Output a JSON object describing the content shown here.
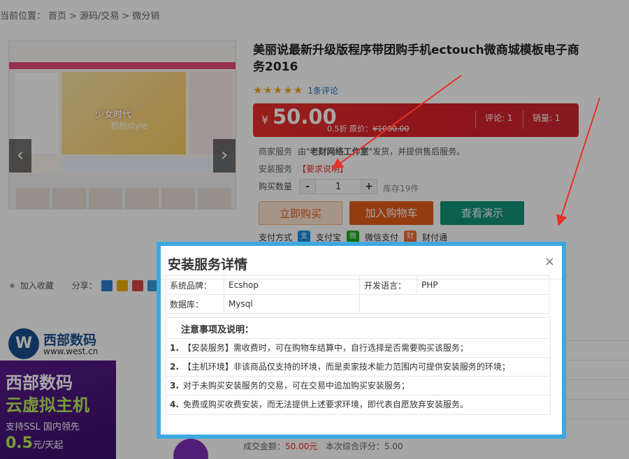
{
  "breadcrumb": {
    "label": "当前位置：",
    "home": "首页",
    "sep": ">",
    "cat": "源码/交易",
    "sub": "微分销"
  },
  "product": {
    "title": "美丽说最新升级版程序带团购手机ectouch微商城模板电子商务2016",
    "hero_banner_text": "少女时代",
    "hero_banner_sub": "初秋style",
    "rating": {
      "stars": 5,
      "star_glyph": "★★★★★",
      "reviews_label": "1条评论"
    },
    "price": {
      "symbol": "¥",
      "value": "50.00",
      "discount": "0.5折",
      "orig_label": "原价：",
      "orig": "¥1000.00",
      "reviews_stat": "评论: 1",
      "sales_stat": "销量: 1"
    },
    "merchant_label": "商家服务",
    "merchant_text_pre": "由\"",
    "merchant_name": "老财网络工作室",
    "merchant_text_post": "\"发货，并提供售后服务。",
    "install_label": "安装服务",
    "install_link": "【要求说明】",
    "qty_label": "购买数量",
    "qty_minus": "-",
    "qty_value": "1",
    "qty_plus": "+",
    "stock": "库存19件",
    "buttons": {
      "buy": "立即购买",
      "cart": "加入购物车",
      "demo": "查看演示"
    },
    "pay_label": "支付方式",
    "pay_methods": [
      "支付宝",
      "微信支付",
      "财付通"
    ]
  },
  "share": {
    "fav": "加入收藏",
    "share_label": "分享："
  },
  "ad": {
    "brand": "西部数码",
    "url": "www.west.cn",
    "line1": "西部数码",
    "line2": "云虚拟主机",
    "line3": "支持SSL 国内领先",
    "price": "0.5",
    "unit": "元/天起"
  },
  "bottom": {
    "amount_label": "成交金额：",
    "amount": "50.00元",
    "score": "本次综合评分：5.00"
  },
  "modal": {
    "title": "安装服务详情",
    "close": "×",
    "table": [
      {
        "k1": "系统品牌：",
        "v1": "Ecshop",
        "k2": "开发语言：",
        "v2": "PHP"
      },
      {
        "k1": "数据库：",
        "v1": "Mysql",
        "k2": "",
        "v2": ""
      }
    ],
    "notes_title": "注意事项及说明：",
    "notes": [
      {
        "n": "1.",
        "text": "【安装服务】需收费时，可在购物车结算中，自行选择是否需要购买该服务；"
      },
      {
        "n": "2.",
        "text": "【主机环境】非该商品仅支持的环境，而是卖家技术能力范围内可提供安装服务的环境；"
      },
      {
        "n": "3.",
        "text": "对于未购买安装服务的交易，可在交易中追加购买安装服务；"
      },
      {
        "n": "4.",
        "text": "免费或购买收费安装，而无法提供上述要求环境，即代表自愿放弃安装服务。"
      }
    ]
  },
  "colors": {
    "price_red": "#e8302a",
    "modal_border": "#3ea8e0",
    "demo_green": "#119378",
    "cart_orange": "#e35d19",
    "link_blue": "#1f6fc1"
  }
}
